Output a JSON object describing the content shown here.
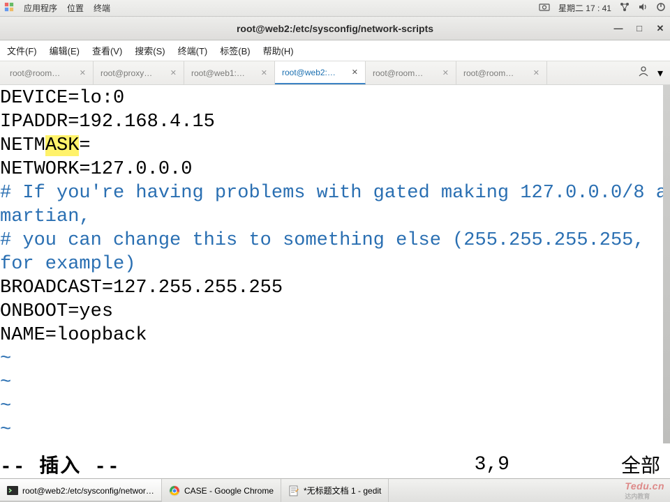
{
  "topbar": {
    "apps": "应用程序",
    "places": "位置",
    "terminal": "终端",
    "weekday_time": "星期二 17 : 41"
  },
  "window": {
    "title": "root@web2:/etc/sysconfig/network-scripts"
  },
  "menubar": {
    "file": "文件(F)",
    "edit": "编辑(E)",
    "view": "查看(V)",
    "search": "搜索(S)",
    "terminal": "终端(T)",
    "tabs": "标签(B)",
    "help": "帮助(H)"
  },
  "tabs": [
    {
      "label": "root@room…",
      "active": false
    },
    {
      "label": "root@proxy…",
      "active": false
    },
    {
      "label": "root@web1:…",
      "active": false
    },
    {
      "label": "root@web2:…",
      "active": true
    },
    {
      "label": "root@room…",
      "active": false
    },
    {
      "label": "root@room…",
      "active": false
    }
  ],
  "editor": {
    "lines": [
      {
        "pre": "DEVICE=lo:0"
      },
      {
        "pre": "IPADDR=192.168.4.15"
      },
      {
        "pre": "NETM",
        "hl": "ASK",
        "post": "="
      },
      {
        "pre": "NETWORK=127.0.0.0"
      },
      {
        "comment": "# If you're having problems with gated making 127.0.0.0/8 a martian,"
      },
      {
        "comment": "# you can change this to something else (255.255.255.255, for example)"
      },
      {
        "pre": "BROADCAST=127.255.255.255"
      },
      {
        "pre": "ONBOOT=yes"
      },
      {
        "pre": "NAME=loopback"
      }
    ],
    "tildes": [
      "~",
      "~",
      "~",
      "~"
    ]
  },
  "status": {
    "mode": "-- 插入 --",
    "pos": "3,9",
    "pct": "全部"
  },
  "taskbar": {
    "items": [
      {
        "label": "root@web2:/etc/sysconfig/networ…",
        "active": true,
        "icon": "terminal"
      },
      {
        "label": "CASE - Google Chrome",
        "active": false,
        "icon": "chrome"
      },
      {
        "label": "*无标题文档 1 - gedit",
        "active": false,
        "icon": "gedit"
      }
    ]
  },
  "watermark": {
    "brand": "Tedu.cn",
    "sub": "达内教育"
  }
}
